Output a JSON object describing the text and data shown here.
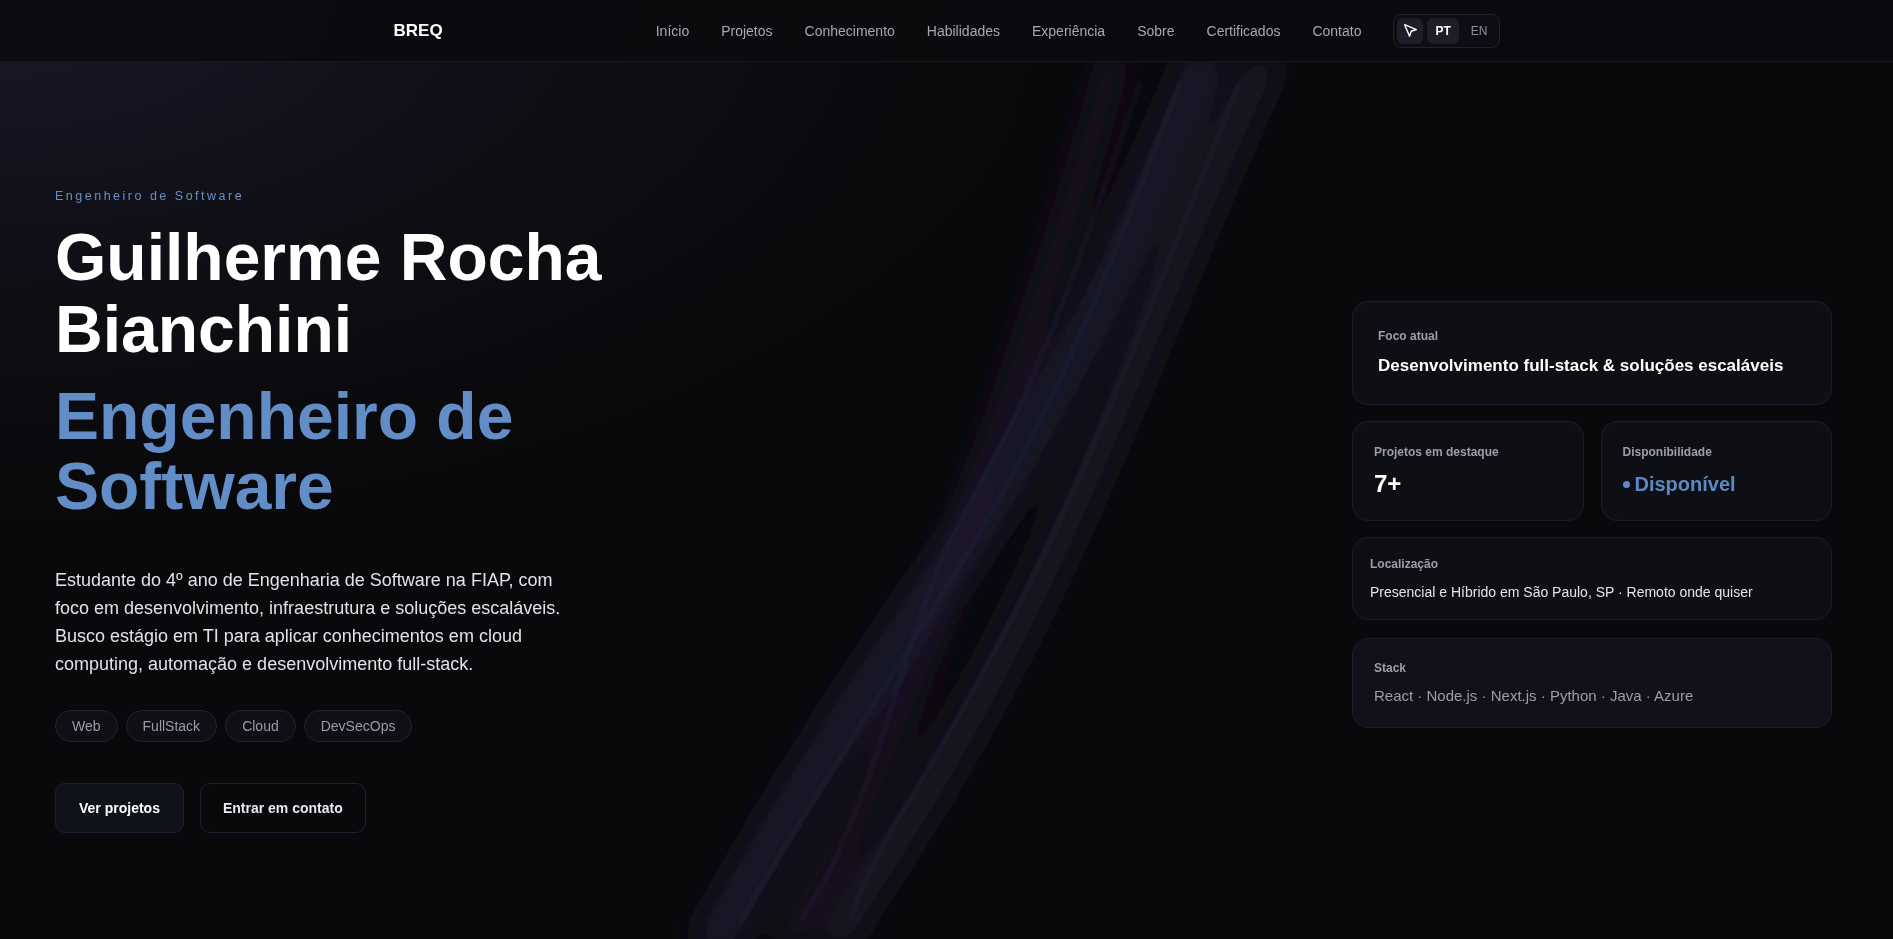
{
  "nav": {
    "logo": "BREQ",
    "links": [
      "Início",
      "Projetos",
      "Conhecimento",
      "Habilidades",
      "Experiência",
      "Sobre",
      "Certificados",
      "Contato"
    ],
    "cursor_toggle": {
      "on": true
    },
    "languages": [
      {
        "label": "PT",
        "selected": true
      },
      {
        "label": "EN",
        "selected": false
      }
    ]
  },
  "hero": {
    "eyebrow": "Engenheiro de Software",
    "name": "Guilherme Rocha Bianchini",
    "role": "Engenheiro de Software",
    "description": "Estudante do 4º ano de Engenharia de Software na FIAP, com foco em desenvolvimento, infraestrutura e soluções escaláveis. Busco estágio em TI para aplicar conhecimentos em cloud computing, automação e desenvolvimento full-stack.",
    "tags": [
      "Web",
      "FullStack",
      "Cloud",
      "DevSecOps"
    ],
    "buttons": [
      {
        "label": "Ver projetos",
        "kind": "primary"
      },
      {
        "label": "Entrar em contato",
        "kind": "secondary"
      }
    ]
  },
  "cards": {
    "focus": {
      "label": "Foco atual",
      "value": "Desenvolvimento full-stack & soluções escaláveis"
    },
    "stats": [
      {
        "kind": "count",
        "label": "Projetos em destaque",
        "value": "7+"
      },
      {
        "kind": "status",
        "label": "Disponibilidade",
        "value": "Disponível"
      }
    ],
    "location": {
      "label": "Localização",
      "value": "Presencial e Híbrido em São Paulo, SP · Remoto onde quiser"
    },
    "stack": {
      "label": "Stack",
      "value": "React · Node.js · Next.js · Python · Java · Azure"
    }
  }
}
